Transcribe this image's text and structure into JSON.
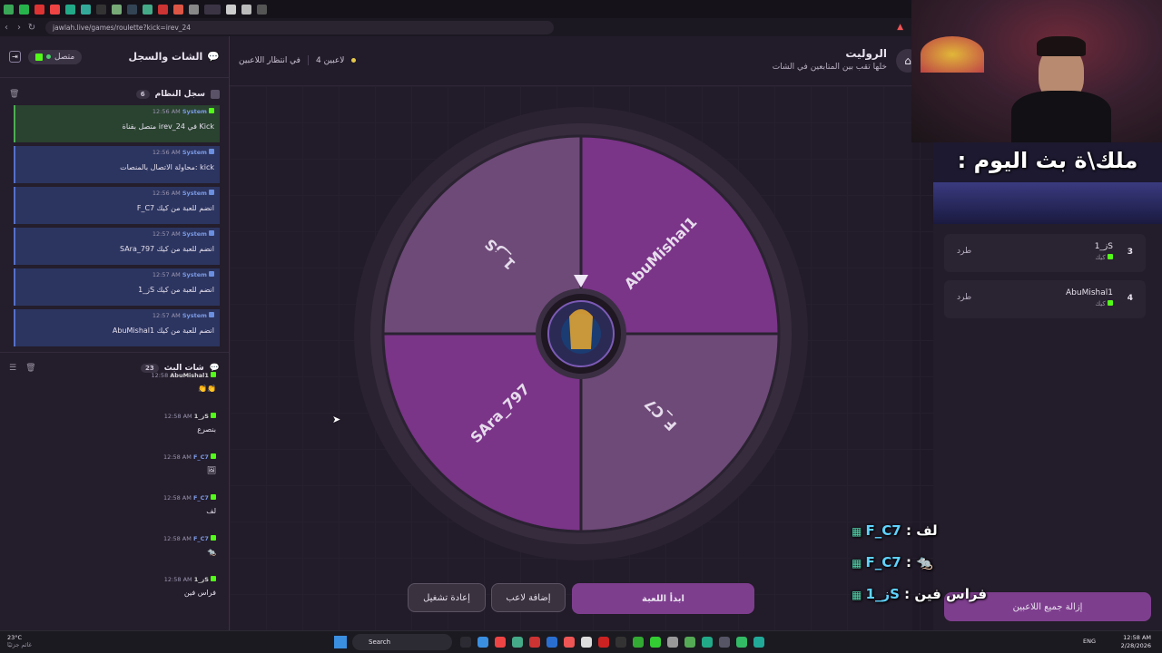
{
  "browser": {
    "url": "jawlah.live/games/roulette?kick=irev_24",
    "tab_icons": [
      "#3aa757",
      "#27b34b",
      "#d33",
      "#e44",
      "#2a8",
      "#3a9",
      "#333",
      "#7a7",
      "#345",
      "#4a8",
      "#c33",
      "#d54",
      "#888",
      "#999",
      "#ccc",
      "#bbb",
      "#555"
    ]
  },
  "header": {
    "title": "الروليت",
    "subtitle": "خلها تقب بين المتابعين في الشات",
    "players_count": "4 لاعبين",
    "status": "في انتظار اللاعبين"
  },
  "left_panel": {
    "title": "الشات والسجل",
    "connection": "متصل",
    "system_log": {
      "title": "سجل النظام",
      "count": "6",
      "messages": [
        {
          "user": "System",
          "time": "12:56 AM",
          "text": "متصل بقناة irev_24 في Kick",
          "platform": "kick"
        },
        {
          "user": "System",
          "time": "12:56 AM",
          "text": "محاولة الاتصال بالمنصات: kick",
          "platform": "system"
        },
        {
          "user": "System",
          "time": "12:56 AM",
          "text": "F_C7 انضم للعبة من كيك",
          "platform": "system"
        },
        {
          "user": "System",
          "time": "12:57 AM",
          "text": "SAra_797 انضم للعبة من كيك",
          "platform": "system"
        },
        {
          "user": "System",
          "time": "12:57 AM",
          "text": "ز_1S انضم للعبة من كيك",
          "platform": "system"
        },
        {
          "user": "System",
          "time": "12:57 AM",
          "text": "AbuMishal1 انضم للعبة من كيك",
          "platform": "system"
        }
      ]
    },
    "stream_chat": {
      "title": "شات البث",
      "count": "23",
      "messages": [
        {
          "user": "AbuMishal1",
          "time": "12:58",
          "text": "👏👏",
          "kind": "k"
        },
        {
          "user": "ز_1S",
          "time": "12:58 AM",
          "text": "بنصرع",
          "kind": "k"
        },
        {
          "user": "F_C7",
          "time": "12:58 AM",
          "text": "🖼",
          "kind": "f"
        },
        {
          "user": "F_C7",
          "time": "12:58 AM",
          "text": "لف",
          "kind": "f"
        },
        {
          "user": "F_C7",
          "time": "12:58 AM",
          "text": "🐀",
          "kind": "f"
        },
        {
          "user": "ز_1S",
          "time": "12:58 AM",
          "text": "فراس فين",
          "kind": "k"
        }
      ]
    }
  },
  "wheel": {
    "segments": [
      {
        "name": "ز_1S",
        "color": "#6e4a78"
      },
      {
        "name": "AbuMishal1",
        "color": "#7a3488"
      },
      {
        "name": "F_C7",
        "color": "#6e4a78"
      },
      {
        "name": "SAra_797",
        "color": "#7a3488"
      }
    ]
  },
  "buttons": {
    "start": "ابدأ اللعبة",
    "add_player": "إضافة لاعب",
    "restart": "إعادة تشغيل",
    "remove_all": "إزالة جميع اللاعبين"
  },
  "players": [
    {
      "index": "3",
      "name": "ز_1S",
      "platform": "كيك",
      "kick_label": "طرد"
    },
    {
      "index": "4",
      "name": "AbuMishal1",
      "platform": "كيك",
      "kick_label": "طرد"
    }
  ],
  "overlay": {
    "banner": ": ملك\\ة بث اليوم",
    "chat": [
      {
        "user": "F_C7",
        "text": ": لف"
      },
      {
        "user": "F_C7",
        "text": ": 🐀"
      },
      {
        "user": "ز_1S",
        "text": ": فراس فين"
      }
    ]
  },
  "taskbar": {
    "weather": "23°C",
    "weather_sub": "غائم جزئيًا",
    "search": "Search",
    "lang": "ENG",
    "time": "12:58 AM",
    "date": "2/28/2026"
  }
}
